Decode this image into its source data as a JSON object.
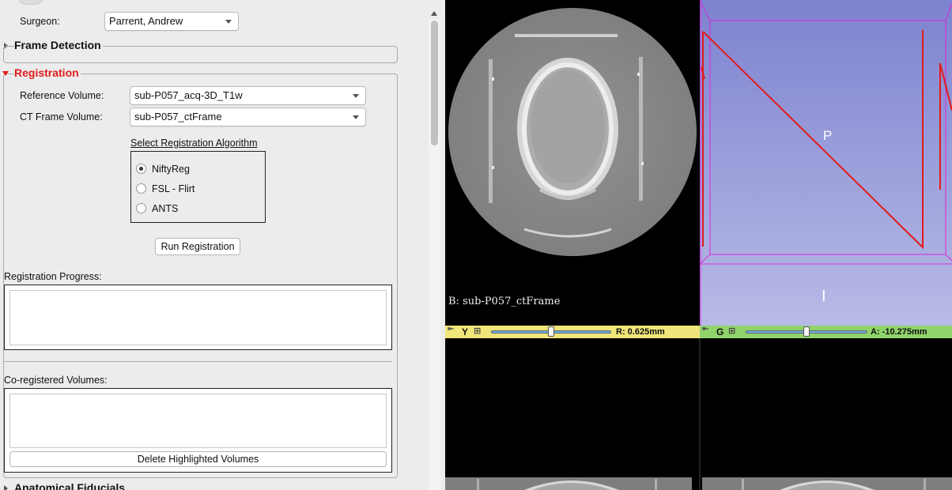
{
  "surgeon": {
    "label": "Surgeon:",
    "value": "Parrent, Andrew"
  },
  "frame_detection": {
    "title": "Frame Detection"
  },
  "registration": {
    "title": "Registration",
    "reference_volume": {
      "label": "Reference Volume:",
      "value": "sub-P057_acq-3D_T1w"
    },
    "ct_frame_volume": {
      "label": "CT Frame Volume:",
      "value": "sub-P057_ctFrame"
    },
    "algorithm": {
      "title": "Select Registration Algorithm",
      "options": [
        "NiftyReg",
        "FSL - Flirt",
        "ANTS"
      ],
      "selected": "NiftyReg"
    },
    "run_button": "Run Registration",
    "progress_label": "Registration Progress:",
    "coregistered_label": "Co-registered Volumes:",
    "delete_button": "Delete Highlighted Volumes"
  },
  "anatomical_fiducials": {
    "title": "Anatomical Fiducials"
  },
  "viewers": {
    "yellow": {
      "letter": "Y",
      "volume_label": "B: sub-P057_ctFrame",
      "offset": "R: 0.625mm",
      "slider_fraction": 0.5
    },
    "green": {
      "letter": "G",
      "offset": "A: -10.275mm",
      "slider_fraction": 0.5
    },
    "threed": {
      "orientation_label": "P",
      "marker": "I"
    }
  },
  "colors": {
    "accent_red": "#e21b1b",
    "yellow_bar": "#f0e57a",
    "green_bar": "#8fd36a",
    "threed_bg": "#9c9fd9",
    "roi_magenta": "#d42bd9"
  }
}
